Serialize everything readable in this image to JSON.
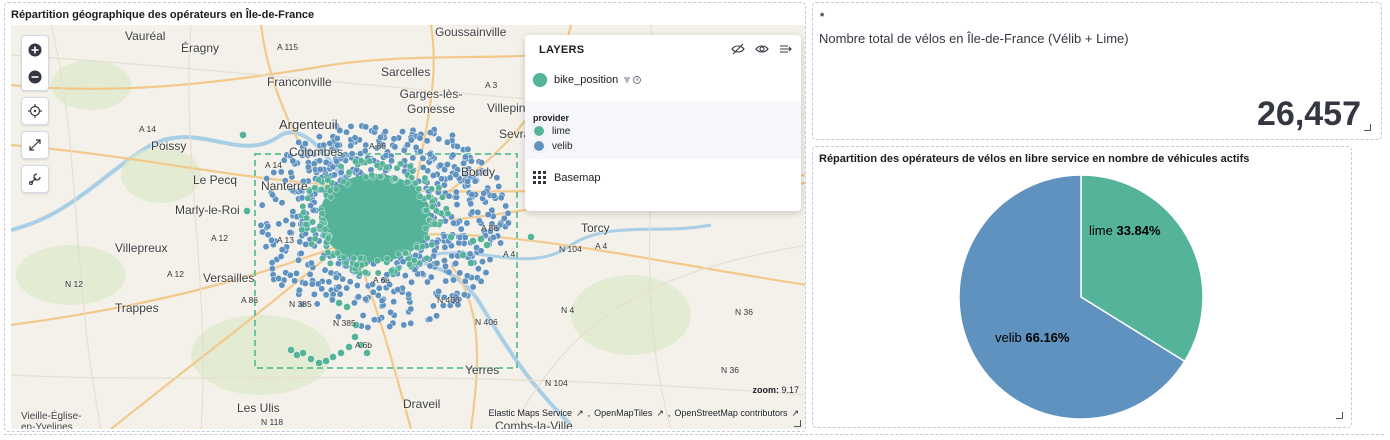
{
  "map_panel": {
    "title": "Répartition géographique des opérateurs en Île-de-France",
    "places": [
      "Vauréal",
      "Éragny",
      "Goussainville",
      "Franconville",
      "Sarcelles",
      "Garges-lès-Gonesse",
      "Villepinte",
      "Argenteuil",
      "Colombes",
      "Poissy",
      "Le Pecq",
      "Nanterre",
      "Bondy",
      "Marly-le-Roi",
      "Torcy",
      "Villepreux",
      "Versailles",
      "Trappes",
      "Yerres",
      "Les Ulis",
      "Draveil",
      "Vieille-Église-en-Yvelines",
      "Combs-la-Ville",
      "Sevran"
    ],
    "roads": [
      "A 115",
      "A 3",
      "A 14",
      "A 86",
      "A 14",
      "A 12",
      "A 13",
      "A 86",
      "A 4",
      "N 104",
      "A 4",
      "A 12",
      "N 12",
      "A 86",
      "N 385",
      "A 6a",
      "N 406",
      "N 406",
      "N 4",
      "N 385",
      "A 6b",
      "N 36",
      "N 36",
      "N 104",
      "N 118"
    ],
    "layers": {
      "header": "LAYERS",
      "layer_name": "bike_position",
      "legend_title": "provider",
      "items": [
        {
          "label": "lime",
          "color": "#54b399"
        },
        {
          "label": "velib",
          "color": "#6092c0"
        }
      ],
      "basemap_label": "Basemap"
    },
    "zoom_label": "zoom:",
    "zoom_value": "9.17",
    "attributions": [
      "Elastic Maps Service",
      "OpenMapTiles",
      "OpenStreetMap contributors"
    ]
  },
  "metric_panel": {
    "marker": "*",
    "label": "Nombre total de vélos en Île-de-France (Vélib + Lime)",
    "value": "26,457"
  },
  "pie_panel": {
    "title": "Répartition des opérateurs de vélos en libre service en nombre de véhicules actifs",
    "slices": [
      {
        "name": "lime",
        "percent_label": "33.84%",
        "value": 33.84,
        "color": "#54b399"
      },
      {
        "name": "velib",
        "percent_label": "66.16%",
        "value": 66.16,
        "color": "#6092c0"
      }
    ]
  }
}
